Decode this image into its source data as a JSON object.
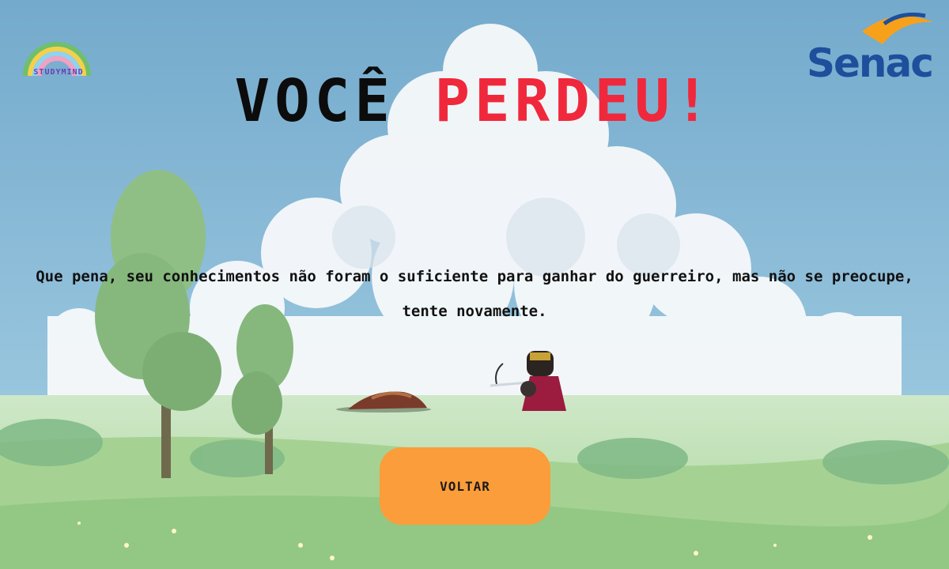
{
  "title": {
    "word1": "VOCÊ",
    "word2": "PERDEU!"
  },
  "message": "Que pena, seu conhecimentos não foram o suficiente para ganhar do guerreiro, mas não se preocupe, tente novamente.",
  "button": {
    "label": "VOLTAR"
  },
  "logos": {
    "left_text": "STUDYMIND",
    "right_text": "Senac"
  },
  "colors": {
    "sky": "#7fb3d3",
    "title_black": "#0c0c0c",
    "title_red": "#f0283c",
    "button": "#fb9d3a",
    "senac_blue": "#1e4f9c",
    "senac_orange": "#f7a11a"
  },
  "icons": {
    "left_logo": "rainbow-logo-icon",
    "right_logo": "senac-logo-icon",
    "fallen_character": "fallen-warrior-sprite",
    "warrior": "warrior-sprite"
  }
}
